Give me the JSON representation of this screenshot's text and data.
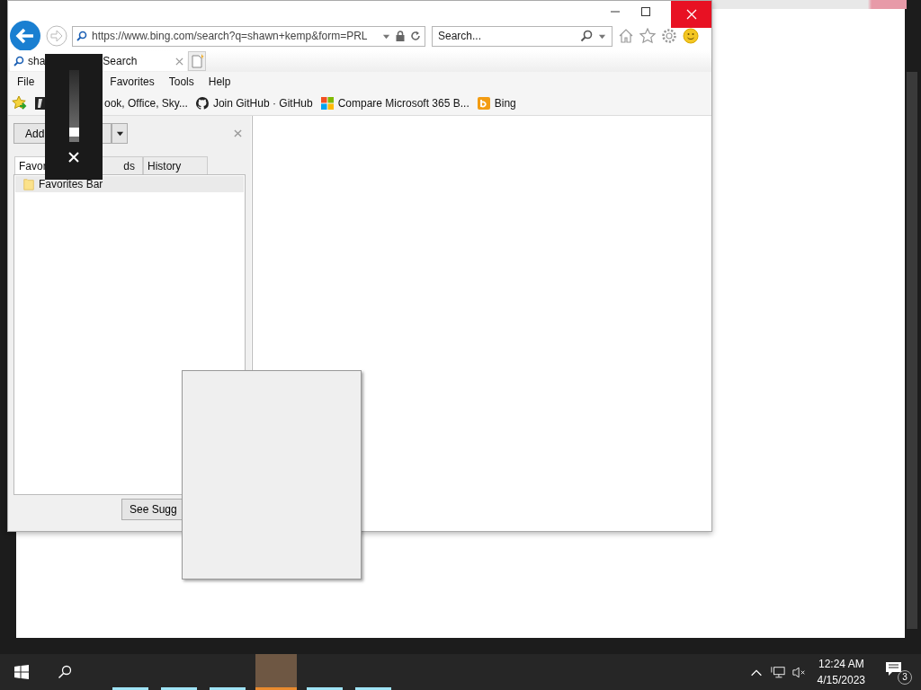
{
  "browser": {
    "address": "https://www.bing.com/search?q=shawn+kemp&form=PRL",
    "search_placeholder": "Search...",
    "tab": {
      "title_parts": [
        "sha",
        "Search"
      ],
      "selected": true
    },
    "menu": [
      "File",
      "Favorites",
      "Tools",
      "Help"
    ],
    "favorites_bar": [
      {
        "kind": "partial",
        "label": "ook, Office, Sky..."
      },
      {
        "kind": "github",
        "label": "Join GitHub · GitHub"
      },
      {
        "kind": "microsoft",
        "label": "Compare Microsoft 365 B..."
      },
      {
        "kind": "bing",
        "label": "Bing"
      }
    ],
    "favorites_center": {
      "add_button": "Add",
      "tabs": [
        {
          "label": "Favor",
          "selected": true
        },
        {
          "label": "ds",
          "selected": false
        },
        {
          "label": "History",
          "selected": false
        }
      ],
      "tree": [
        {
          "label": "Favorites Bar",
          "selected": true
        }
      ],
      "suggest_button": "See Sugg"
    }
  },
  "volume": {
    "level": 0.08
  },
  "taskbar": {
    "apps": [
      {
        "active": false
      },
      {
        "active": false
      },
      {
        "active": false
      },
      {
        "active": true
      },
      {
        "active": false
      },
      {
        "active": false
      }
    ],
    "time": "12:24 AM",
    "date": "4/15/2023",
    "notifications": "3"
  }
}
